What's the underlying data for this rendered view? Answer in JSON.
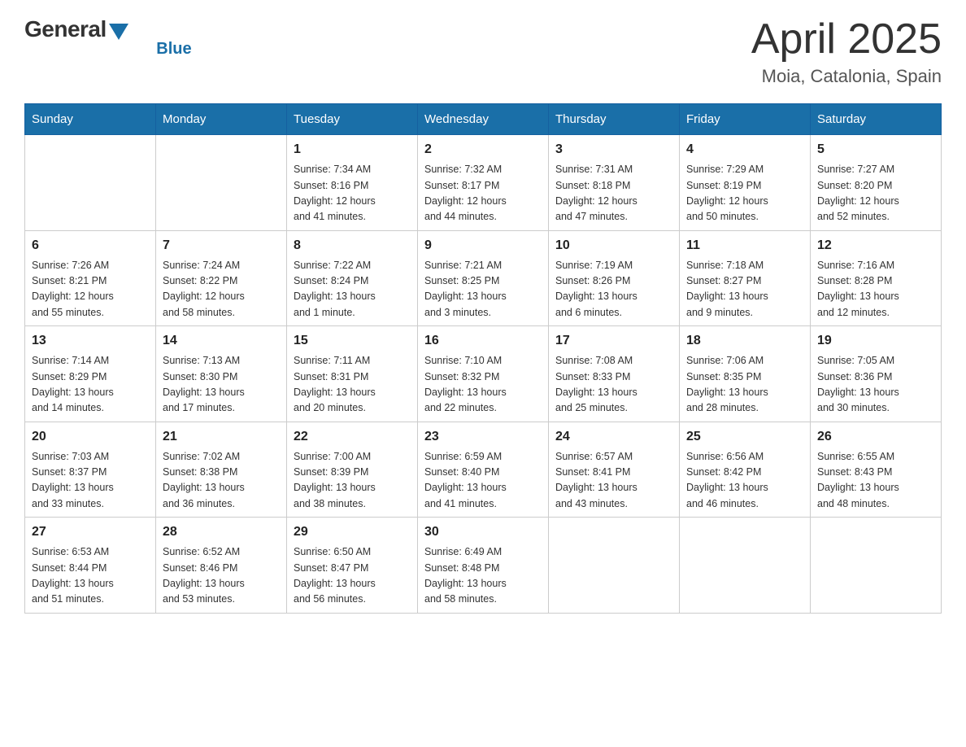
{
  "header": {
    "logo_general": "General",
    "logo_blue": "Blue",
    "title": "April 2025",
    "subtitle": "Moia, Catalonia, Spain"
  },
  "days_of_week": [
    "Sunday",
    "Monday",
    "Tuesday",
    "Wednesday",
    "Thursday",
    "Friday",
    "Saturday"
  ],
  "weeks": [
    [
      {
        "day": "",
        "info": ""
      },
      {
        "day": "",
        "info": ""
      },
      {
        "day": "1",
        "info": "Sunrise: 7:34 AM\nSunset: 8:16 PM\nDaylight: 12 hours\nand 41 minutes."
      },
      {
        "day": "2",
        "info": "Sunrise: 7:32 AM\nSunset: 8:17 PM\nDaylight: 12 hours\nand 44 minutes."
      },
      {
        "day": "3",
        "info": "Sunrise: 7:31 AM\nSunset: 8:18 PM\nDaylight: 12 hours\nand 47 minutes."
      },
      {
        "day": "4",
        "info": "Sunrise: 7:29 AM\nSunset: 8:19 PM\nDaylight: 12 hours\nand 50 minutes."
      },
      {
        "day": "5",
        "info": "Sunrise: 7:27 AM\nSunset: 8:20 PM\nDaylight: 12 hours\nand 52 minutes."
      }
    ],
    [
      {
        "day": "6",
        "info": "Sunrise: 7:26 AM\nSunset: 8:21 PM\nDaylight: 12 hours\nand 55 minutes."
      },
      {
        "day": "7",
        "info": "Sunrise: 7:24 AM\nSunset: 8:22 PM\nDaylight: 12 hours\nand 58 minutes."
      },
      {
        "day": "8",
        "info": "Sunrise: 7:22 AM\nSunset: 8:24 PM\nDaylight: 13 hours\nand 1 minute."
      },
      {
        "day": "9",
        "info": "Sunrise: 7:21 AM\nSunset: 8:25 PM\nDaylight: 13 hours\nand 3 minutes."
      },
      {
        "day": "10",
        "info": "Sunrise: 7:19 AM\nSunset: 8:26 PM\nDaylight: 13 hours\nand 6 minutes."
      },
      {
        "day": "11",
        "info": "Sunrise: 7:18 AM\nSunset: 8:27 PM\nDaylight: 13 hours\nand 9 minutes."
      },
      {
        "day": "12",
        "info": "Sunrise: 7:16 AM\nSunset: 8:28 PM\nDaylight: 13 hours\nand 12 minutes."
      }
    ],
    [
      {
        "day": "13",
        "info": "Sunrise: 7:14 AM\nSunset: 8:29 PM\nDaylight: 13 hours\nand 14 minutes."
      },
      {
        "day": "14",
        "info": "Sunrise: 7:13 AM\nSunset: 8:30 PM\nDaylight: 13 hours\nand 17 minutes."
      },
      {
        "day": "15",
        "info": "Sunrise: 7:11 AM\nSunset: 8:31 PM\nDaylight: 13 hours\nand 20 minutes."
      },
      {
        "day": "16",
        "info": "Sunrise: 7:10 AM\nSunset: 8:32 PM\nDaylight: 13 hours\nand 22 minutes."
      },
      {
        "day": "17",
        "info": "Sunrise: 7:08 AM\nSunset: 8:33 PM\nDaylight: 13 hours\nand 25 minutes."
      },
      {
        "day": "18",
        "info": "Sunrise: 7:06 AM\nSunset: 8:35 PM\nDaylight: 13 hours\nand 28 minutes."
      },
      {
        "day": "19",
        "info": "Sunrise: 7:05 AM\nSunset: 8:36 PM\nDaylight: 13 hours\nand 30 minutes."
      }
    ],
    [
      {
        "day": "20",
        "info": "Sunrise: 7:03 AM\nSunset: 8:37 PM\nDaylight: 13 hours\nand 33 minutes."
      },
      {
        "day": "21",
        "info": "Sunrise: 7:02 AM\nSunset: 8:38 PM\nDaylight: 13 hours\nand 36 minutes."
      },
      {
        "day": "22",
        "info": "Sunrise: 7:00 AM\nSunset: 8:39 PM\nDaylight: 13 hours\nand 38 minutes."
      },
      {
        "day": "23",
        "info": "Sunrise: 6:59 AM\nSunset: 8:40 PM\nDaylight: 13 hours\nand 41 minutes."
      },
      {
        "day": "24",
        "info": "Sunrise: 6:57 AM\nSunset: 8:41 PM\nDaylight: 13 hours\nand 43 minutes."
      },
      {
        "day": "25",
        "info": "Sunrise: 6:56 AM\nSunset: 8:42 PM\nDaylight: 13 hours\nand 46 minutes."
      },
      {
        "day": "26",
        "info": "Sunrise: 6:55 AM\nSunset: 8:43 PM\nDaylight: 13 hours\nand 48 minutes."
      }
    ],
    [
      {
        "day": "27",
        "info": "Sunrise: 6:53 AM\nSunset: 8:44 PM\nDaylight: 13 hours\nand 51 minutes."
      },
      {
        "day": "28",
        "info": "Sunrise: 6:52 AM\nSunset: 8:46 PM\nDaylight: 13 hours\nand 53 minutes."
      },
      {
        "day": "29",
        "info": "Sunrise: 6:50 AM\nSunset: 8:47 PM\nDaylight: 13 hours\nand 56 minutes."
      },
      {
        "day": "30",
        "info": "Sunrise: 6:49 AM\nSunset: 8:48 PM\nDaylight: 13 hours\nand 58 minutes."
      },
      {
        "day": "",
        "info": ""
      },
      {
        "day": "",
        "info": ""
      },
      {
        "day": "",
        "info": ""
      }
    ]
  ]
}
